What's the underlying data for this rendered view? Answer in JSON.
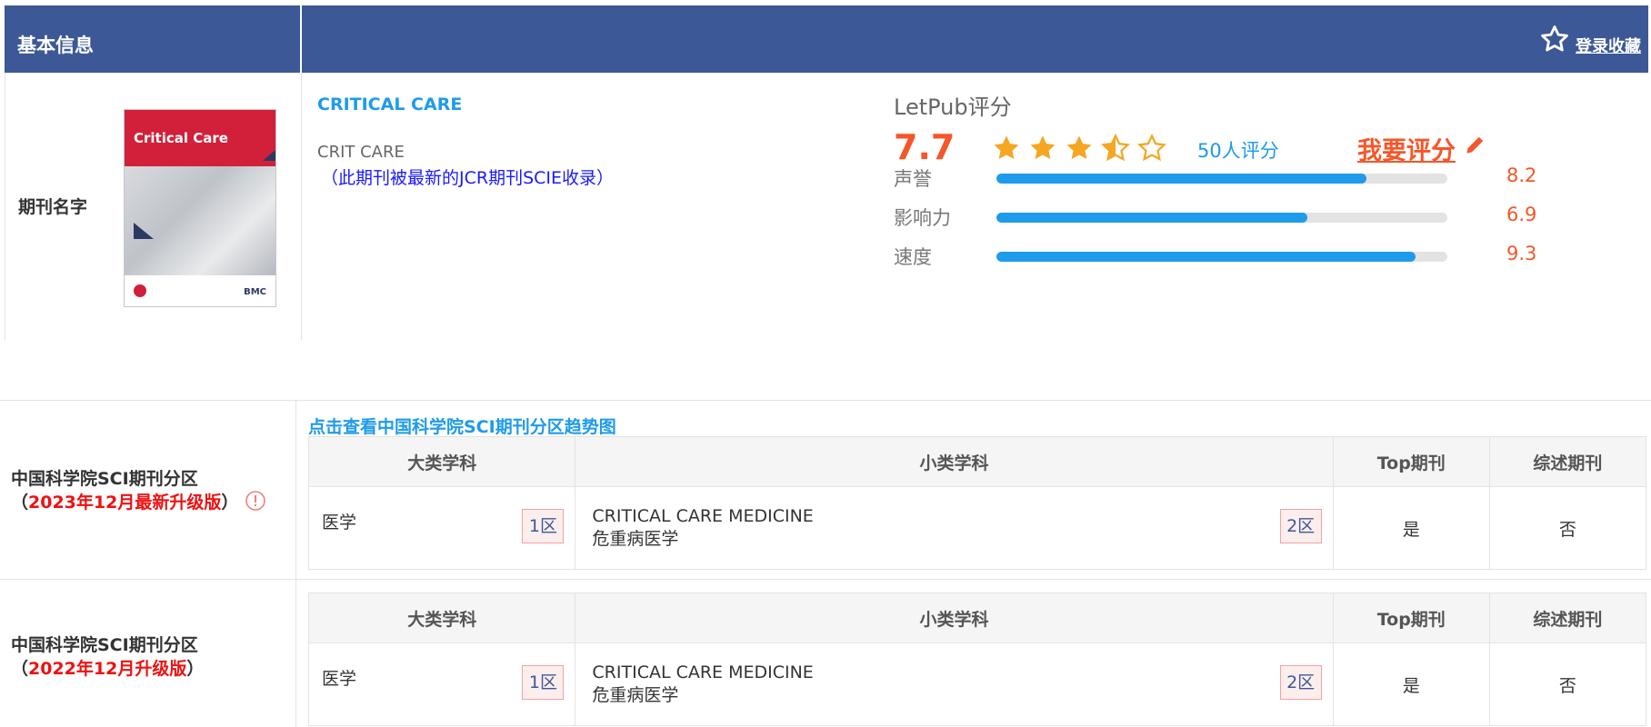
{
  "header": {
    "title": "基本信息",
    "favorite_label": "登录收藏"
  },
  "journal": {
    "row_label": "期刊名字",
    "cover_title": "Critical Care",
    "cover_publisher": "BMC",
    "name": "CRITICAL CARE",
    "abbreviation": "CRIT CARE",
    "jcr_note": "（此期刊被最新的JCR期刊SCIE收录）"
  },
  "letpub": {
    "title": "LetPub评分",
    "score": "7.7",
    "stars": 3.5,
    "votes": "50人评分",
    "rate_label": "我要评分",
    "metrics": [
      {
        "label": "声誉",
        "value": "8.2",
        "fraction": 0.82
      },
      {
        "label": "影响力",
        "value": "6.9",
        "fraction": 0.69
      },
      {
        "label": "速度",
        "value": "9.3",
        "fraction": 0.93
      }
    ]
  },
  "trend_link": "点击查看中国科学院SCI期刊分区趋势图",
  "columns": [
    "大类学科",
    "小类学科",
    "Top期刊",
    "综述期刊"
  ],
  "partitions": [
    {
      "label_line1": "中国科学院SCI期刊分区",
      "label_open": "（",
      "label_version": "2023年12月最新升级版",
      "label_close": "）",
      "category": "医学",
      "category_zone": "1区",
      "sub_en": "CRITICAL CARE MEDICINE",
      "sub_cn": "危重病医学",
      "sub_zone": "2区",
      "top": "是",
      "review": "否"
    },
    {
      "label_line1": "中国科学院SCI期刊分区",
      "label_open": "（",
      "label_version": "2022年12月升级版",
      "label_close": "）",
      "category": "医学",
      "category_zone": "1区",
      "sub_en": "CRITICAL CARE MEDICINE",
      "sub_cn": "危重病医学",
      "sub_zone": "2区",
      "top": "是",
      "review": "否"
    }
  ],
  "colors": {
    "header_bg": "#3c5897",
    "accent_blue": "#1e9bea",
    "accent_orange": "#f5562a",
    "red": "#ee1111"
  }
}
